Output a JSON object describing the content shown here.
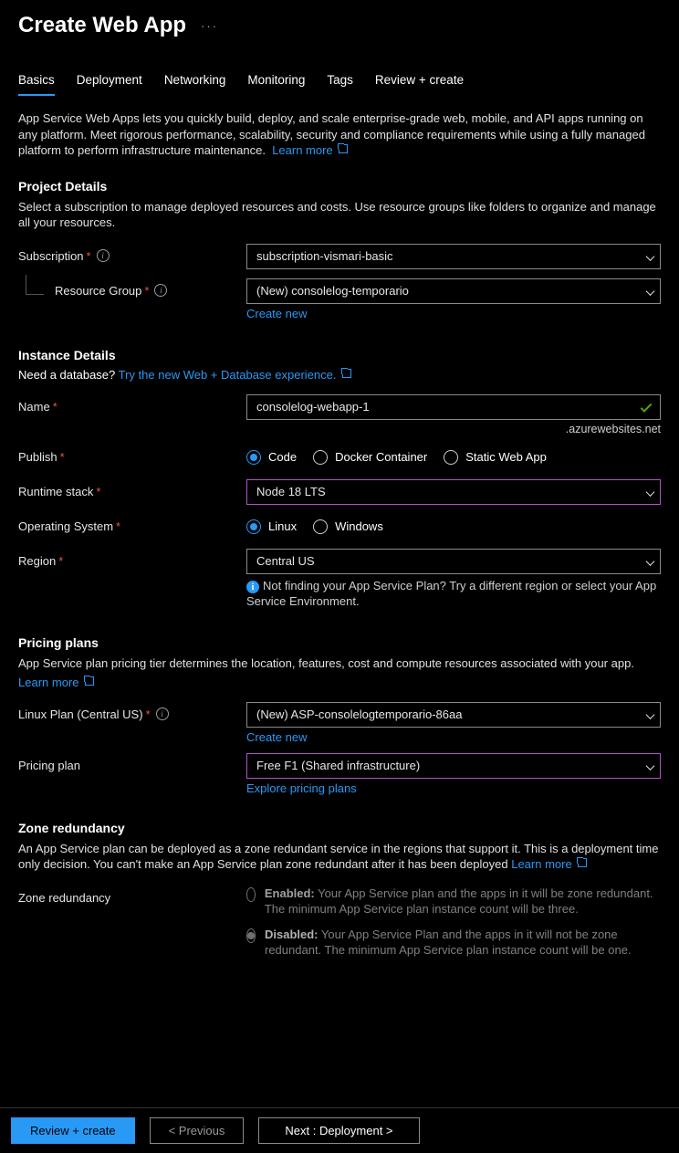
{
  "header": {
    "title": "Create Web App"
  },
  "tabs": [
    "Basics",
    "Deployment",
    "Networking",
    "Monitoring",
    "Tags",
    "Review + create"
  ],
  "intro": {
    "text": "App Service Web Apps lets you quickly build, deploy, and scale enterprise-grade web, mobile, and API apps running on any platform. Meet rigorous performance, scalability, security and compliance requirements while using a fully managed platform to perform infrastructure maintenance.",
    "learn_more": "Learn more"
  },
  "project": {
    "title": "Project Details",
    "desc": "Select a subscription to manage deployed resources and costs. Use resource groups like folders to organize and manage all your resources.",
    "subscription_label": "Subscription",
    "subscription_value": "subscription-vismari-basic",
    "rg_label": "Resource Group",
    "rg_value": "(New) consolelog-temporario",
    "create_new": "Create new"
  },
  "instance": {
    "title": "Instance Details",
    "db_prompt": "Need a database?",
    "db_link": "Try the new Web + Database experience.",
    "name_label": "Name",
    "name_value": "consolelog-webapp-1",
    "domain_suffix": ".azurewebsites.net",
    "publish_label": "Publish",
    "publish_options": [
      "Code",
      "Docker Container",
      "Static Web App"
    ],
    "runtime_label": "Runtime stack",
    "runtime_value": "Node 18 LTS",
    "os_label": "Operating System",
    "os_options": [
      "Linux",
      "Windows"
    ],
    "region_label": "Region",
    "region_value": "Central US",
    "region_note": "Not finding your App Service Plan? Try a different region or select your App Service Environment."
  },
  "pricing": {
    "title": "Pricing plans",
    "desc": "App Service plan pricing tier determines the location, features, cost and compute resources associated with your app.",
    "learn_more": "Learn more",
    "plan_label": "Linux Plan (Central US)",
    "plan_value": "(New) ASP-consolelogtemporario-86aa",
    "create_new": "Create new",
    "tier_label": "Pricing plan",
    "tier_value": "Free F1 (Shared infrastructure)",
    "explore": "Explore pricing plans"
  },
  "zone": {
    "title": "Zone redundancy",
    "desc": "An App Service plan can be deployed as a zone redundant service in the regions that support it. This is a deployment time only decision. You can't make an App Service plan zone redundant after it has been deployed",
    "learn_more": "Learn more",
    "label": "Zone redundancy",
    "enabled_title": "Enabled:",
    "enabled_desc": "Your App Service plan and the apps in it will be zone redundant. The minimum App Service plan instance count will be three.",
    "disabled_title": "Disabled:",
    "disabled_desc": "Your App Service Plan and the apps in it will not be zone redundant. The minimum App Service plan instance count will be one."
  },
  "footer": {
    "review": "Review + create",
    "previous": "< Previous",
    "next": "Next : Deployment >"
  }
}
